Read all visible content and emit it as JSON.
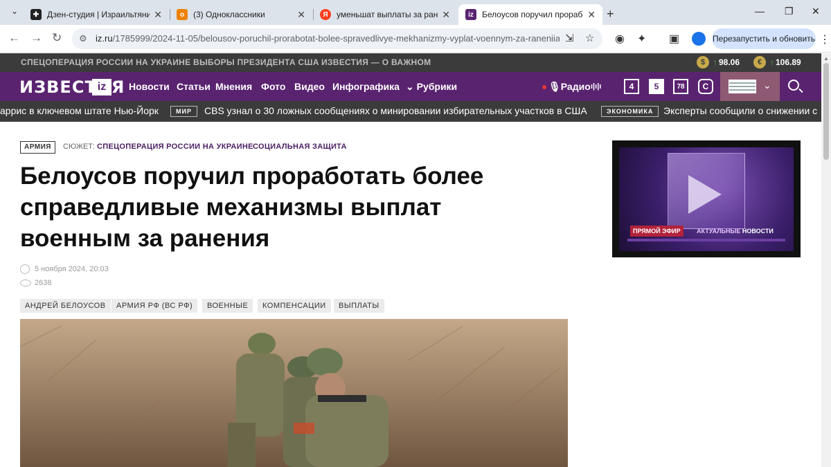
{
  "browser": {
    "tabs": [
      {
        "title": "Дзен-студия | Израильтянин м",
        "favicon": "Д",
        "favicon_color": "#222222"
      },
      {
        "title": "(3) Одноклассники",
        "favicon": "ok",
        "favicon_color": "#ee8208"
      },
      {
        "title": "уменьшат выплаты за ранени",
        "favicon": "Я",
        "favicon_color": "#fc3f1d"
      },
      {
        "title": "Белоусов поручил проработа",
        "favicon": "iz",
        "favicon_color": "#5a2370"
      }
    ],
    "url_host": "iz.ru",
    "url_path": "/1785999/2024-11-05/belousov-poruchil-prorabotat-bolee-spravedlivye-mekhanizmy-vyplat-voennym-za-raneniia",
    "relaunch_label": "Перезапустить и обновить"
  },
  "site": {
    "top_links": [
      "СПЕЦОПЕРАЦИЯ РОССИИ НА УКРАИНЕ",
      "ВЫБОРЫ ПРЕЗИДЕНТА США",
      "ИЗВЕСТИЯ — О ВАЖНОМ"
    ],
    "rates": [
      {
        "symbol": "$",
        "value": "98.06"
      },
      {
        "symbol": "€",
        "value": "106.89"
      }
    ],
    "logo": "ИЗВЕСТИЯ",
    "logo_badge": "iz",
    "nav": [
      "Новости",
      "Статьи",
      "Мнения",
      "Фото",
      "Видео",
      "Инфографика",
      "Рубрики"
    ],
    "radio_label": "Радио",
    "radio_wave": "ı|ı|ı",
    "channel_icons": [
      "4",
      "5",
      "78",
      "C"
    ],
    "ticker": [
      {
        "text": "аррис в ключевом штате Нью-Йорк"
      },
      {
        "tag": "МИР",
        "text": "CBS узнал о 30 ложных сообщениях о минировании избирательных участков в США"
      },
      {
        "tag": "ЭКОНОМИКА",
        "text": "Эксперты сообщили о снижении с"
      }
    ]
  },
  "article": {
    "rubric": "АРМИЯ",
    "story_label": "СЮЖЕТ:",
    "story_links": [
      "СПЕЦОПЕРАЦИЯ РОССИИ НА УКРАИНЕ",
      "СОЦИАЛЬНАЯ ЗАЩИТА"
    ],
    "headline": "Белоусов поручил проработать более справедливые механизмы выплат военным за ранения",
    "date": "5 ноября 2024, 20:03",
    "views": "2638",
    "tags": [
      "АНДРЕЙ БЕЛОУСОВ",
      "АРМИЯ РФ (ВС РФ)",
      "ВОЕННЫЕ",
      "КОМПЕНСАЦИИ",
      "ВЫПЛАТЫ"
    ]
  },
  "video": {
    "live_label": "ПРЯМОЙ ЭФИР",
    "news_label_a": "АКТУАЛЬНЫЕ",
    "news_label_b": "НОВОСТИ"
  }
}
